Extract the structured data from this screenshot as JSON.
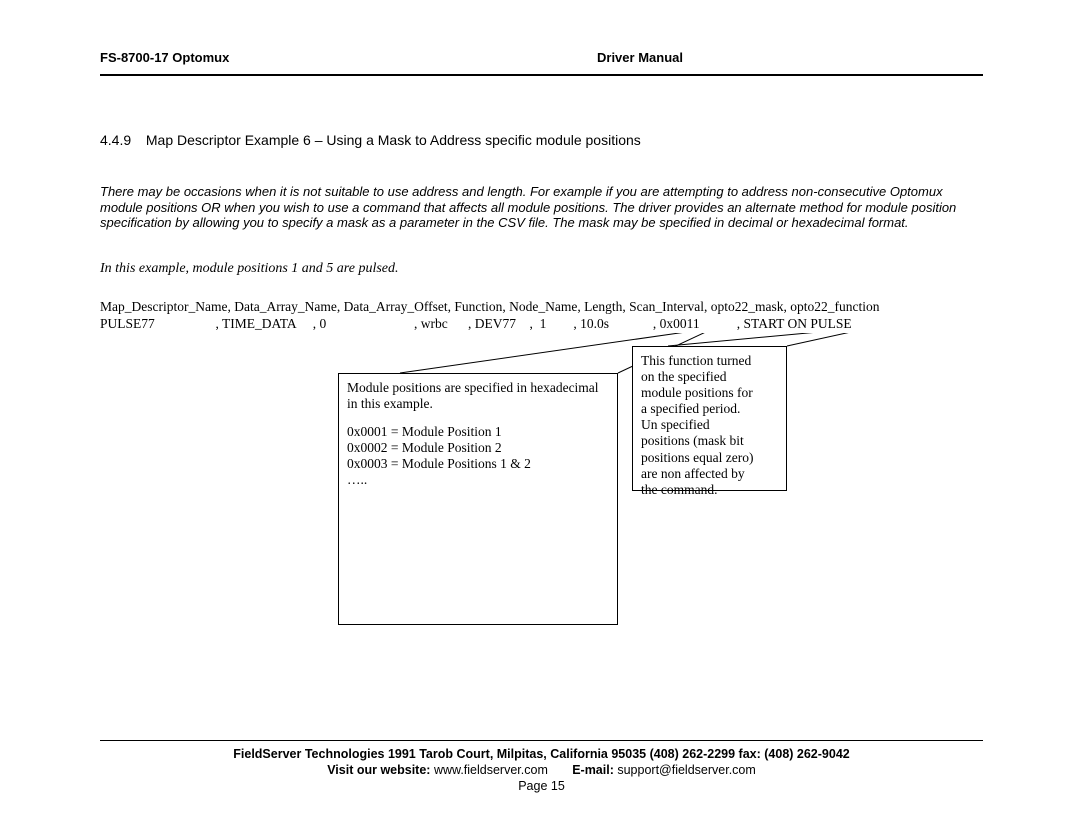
{
  "header": {
    "left": "FS-8700-17 Optomux",
    "right": "Driver Manual"
  },
  "section": {
    "num": "4.4.9",
    "title": "Map Descriptor Example 6 – Using a Mask  to Address specific module positions"
  },
  "intro": "There may be occasions when it is not suitable to use address and length. For example if you are attempting to address non-consecutive Optomux module positions OR when you wish to use a command that affects all module positions. The driver provides an alternate method for module position specification by allowing you to specify a mask as a parameter in the CSV file.  The mask may be specified in decimal or hexadecimal format.",
  "note": "In this example, module positions 1 and 5 are pulsed.",
  "csv": {
    "headers": "Map_Descriptor_Name, Data_Array_Name, Data_Array_Offset, Function, Node_Name, Length, Scan_Interval, opto22_mask, opto22_function",
    "row": "PULSE77                  , TIME_DATA     , 0                          , wrbc      , DEV77    ,  1        , 10.0s             , 0x0011           , START ON PULSE"
  },
  "callout1": {
    "l1": "Module positions are specified in hexadecimal",
    "l2": "in this example.",
    "l3": "0x0001 = Module Position 1",
    "l4": "0x0002 = Module Position 2",
    "l5": "0x0003 = Module Positions 1 & 2",
    "l6": "….."
  },
  "callout2": {
    "l1": "This function turned",
    "l2": "on the specified",
    "l3": "module positions for",
    "l4": "a specified period.",
    "l5": "Un specified",
    "l6": "positions (mask bit",
    "l7": "positions equal zero)",
    "l8": "are non affected by",
    "l9": "the command."
  },
  "footer": {
    "addr": "FieldServer Technologies 1991 Tarob Court, Milpitas, California 95035 (408) 262-2299 fax: (408) 262-9042",
    "web_label": "Visit our website: ",
    "web": "www.fieldserver.com",
    "email_label": "E-mail:",
    "email": " support@fieldserver.com",
    "page": "Page 15"
  }
}
